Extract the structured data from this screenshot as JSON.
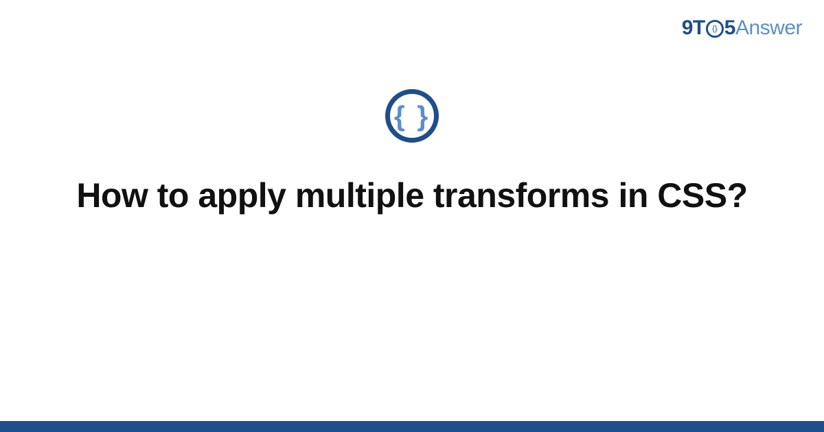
{
  "brand": {
    "part1": "9T",
    "o_inner": "{}",
    "part2": "5",
    "part3": "Answer"
  },
  "badge": {
    "symbol": "{ }"
  },
  "page": {
    "title": "How to apply multiple transforms in CSS?"
  },
  "colors": {
    "brand_dark": "#1e4e8c",
    "brand_light": "#5a8fc8"
  }
}
